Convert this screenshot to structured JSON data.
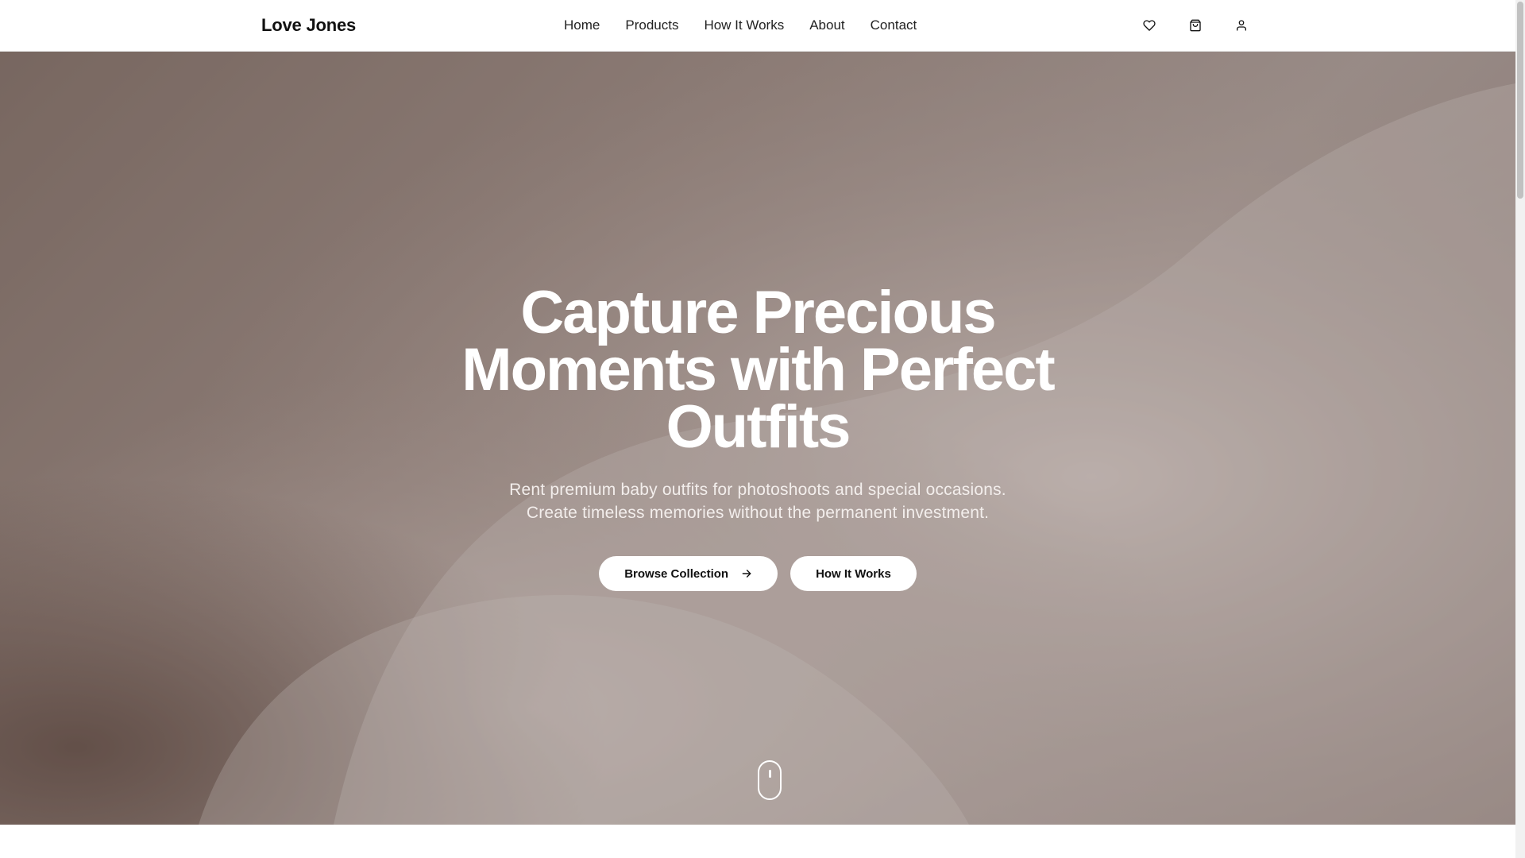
{
  "header": {
    "brand": "Love Jones",
    "nav": [
      "Home",
      "Products",
      "How It Works",
      "About",
      "Contact"
    ],
    "icons": [
      "heart-icon",
      "shopping-bag-icon",
      "user-icon"
    ]
  },
  "hero": {
    "title": "Capture Precious Moments with Perfect Outfits",
    "subtitle_line1": "Rent premium baby outfits for photoshoots and special occasions.",
    "subtitle_line2": "Create timeless memories without the permanent investment.",
    "primary_button": "Browse Collection",
    "secondary_button": "How It Works",
    "scroll_indicator": "mouse-icon"
  },
  "colors": {
    "overlay": "#8c7a72",
    "button_bg": "#ffffff",
    "text_dark": "#111111"
  }
}
